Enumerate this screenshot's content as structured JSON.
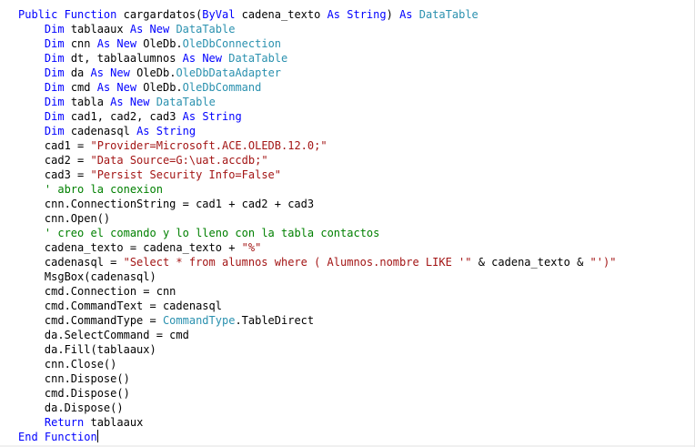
{
  "editor": {
    "lines": [
      [
        [
          "kw",
          "Public Function"
        ],
        [
          "txt",
          " cargardatos("
        ],
        [
          "kw",
          "ByVal"
        ],
        [
          "txt",
          " cadena_texto "
        ],
        [
          "kw",
          "As String"
        ],
        [
          "txt",
          ") "
        ],
        [
          "kw",
          "As"
        ],
        [
          "txt",
          " "
        ],
        [
          "type",
          "DataTable"
        ]
      ],
      [
        [
          "txt",
          "    "
        ],
        [
          "kw",
          "Dim"
        ],
        [
          "txt",
          " tablaaux "
        ],
        [
          "kw",
          "As New"
        ],
        [
          "txt",
          " "
        ],
        [
          "type",
          "DataTable"
        ]
      ],
      [
        [
          "txt",
          "    "
        ],
        [
          "kw",
          "Dim"
        ],
        [
          "txt",
          " cnn "
        ],
        [
          "kw",
          "As New"
        ],
        [
          "txt",
          " OleDb."
        ],
        [
          "type",
          "OleDbConnection"
        ]
      ],
      [
        [
          "txt",
          "    "
        ],
        [
          "kw",
          "Dim"
        ],
        [
          "txt",
          " dt, tablaalumnos "
        ],
        [
          "kw",
          "As New"
        ],
        [
          "txt",
          " "
        ],
        [
          "type",
          "DataTable"
        ]
      ],
      [
        [
          "txt",
          "    "
        ],
        [
          "kw",
          "Dim"
        ],
        [
          "txt",
          " da "
        ],
        [
          "kw",
          "As New"
        ],
        [
          "txt",
          " OleDb."
        ],
        [
          "type",
          "OleDbDataAdapter"
        ]
      ],
      [
        [
          "txt",
          "    "
        ],
        [
          "kw",
          "Dim"
        ],
        [
          "txt",
          " cmd "
        ],
        [
          "kw",
          "As New"
        ],
        [
          "txt",
          " OleDb."
        ],
        [
          "type",
          "OleDbCommand"
        ]
      ],
      [
        [
          "txt",
          "    "
        ],
        [
          "kw",
          "Dim"
        ],
        [
          "txt",
          " tabla "
        ],
        [
          "kw",
          "As New"
        ],
        [
          "txt",
          " "
        ],
        [
          "type",
          "DataTable"
        ]
      ],
      [
        [
          "txt",
          "    "
        ],
        [
          "kw",
          "Dim"
        ],
        [
          "txt",
          " cad1, cad2, cad3 "
        ],
        [
          "kw",
          "As String"
        ]
      ],
      [
        [
          "txt",
          "    "
        ],
        [
          "kw",
          "Dim"
        ],
        [
          "txt",
          " cadenasql "
        ],
        [
          "kw",
          "As String"
        ]
      ],
      [
        [
          "txt",
          "    cad1 = "
        ],
        [
          "str",
          "\"Provider=Microsoft.ACE.OLEDB.12.0;\""
        ]
      ],
      [
        [
          "txt",
          "    cad2 = "
        ],
        [
          "str",
          "\"Data Source=G:\\uat.accdb;\""
        ]
      ],
      [
        [
          "txt",
          "    cad3 = "
        ],
        [
          "str",
          "\"Persist Security Info=False\""
        ]
      ],
      [
        [
          "txt",
          "    "
        ],
        [
          "cmt",
          "' abro la conexion"
        ]
      ],
      [
        [
          "txt",
          "    cnn.ConnectionString = cad1 + cad2 + cad3"
        ]
      ],
      [
        [
          "txt",
          "    cnn.Open()"
        ]
      ],
      [
        [
          "txt",
          "    "
        ],
        [
          "cmt",
          "' creo el comando y lo lleno con la tabla contactos"
        ]
      ],
      [
        [
          "txt",
          "    cadena_texto = cadena_texto + "
        ],
        [
          "str",
          "\"%\""
        ]
      ],
      [
        [
          "txt",
          "    cadenasql = "
        ],
        [
          "str",
          "\"Select * from alumnos where ( Alumnos.nombre LIKE '\""
        ],
        [
          "txt",
          " & cadena_texto & "
        ],
        [
          "str",
          "\"')\""
        ]
      ],
      [
        [
          "txt",
          "    MsgBox(cadenasql)"
        ]
      ],
      [
        [
          "txt",
          "    cmd.Connection = cnn"
        ]
      ],
      [
        [
          "txt",
          "    cmd.CommandText = cadenasql"
        ]
      ],
      [
        [
          "txt",
          "    cmd.CommandType = "
        ],
        [
          "type",
          "CommandType"
        ],
        [
          "txt",
          ".TableDirect"
        ]
      ],
      [
        [
          "txt",
          "    da.SelectCommand = cmd"
        ]
      ],
      [
        [
          "txt",
          "    da.Fill(tablaaux)"
        ]
      ],
      [
        [
          "txt",
          "    cnn.Close()"
        ]
      ],
      [
        [
          "txt",
          "    cnn.Dispose()"
        ]
      ],
      [
        [
          "txt",
          "    cmd.Dispose()"
        ]
      ],
      [
        [
          "txt",
          "    da.Dispose()"
        ]
      ],
      [
        [
          "txt",
          "    "
        ],
        [
          "kw",
          "Return"
        ],
        [
          "txt",
          " tablaaux"
        ]
      ],
      [
        [
          "kw",
          "End Function"
        ]
      ]
    ],
    "caret_line": 29
  }
}
